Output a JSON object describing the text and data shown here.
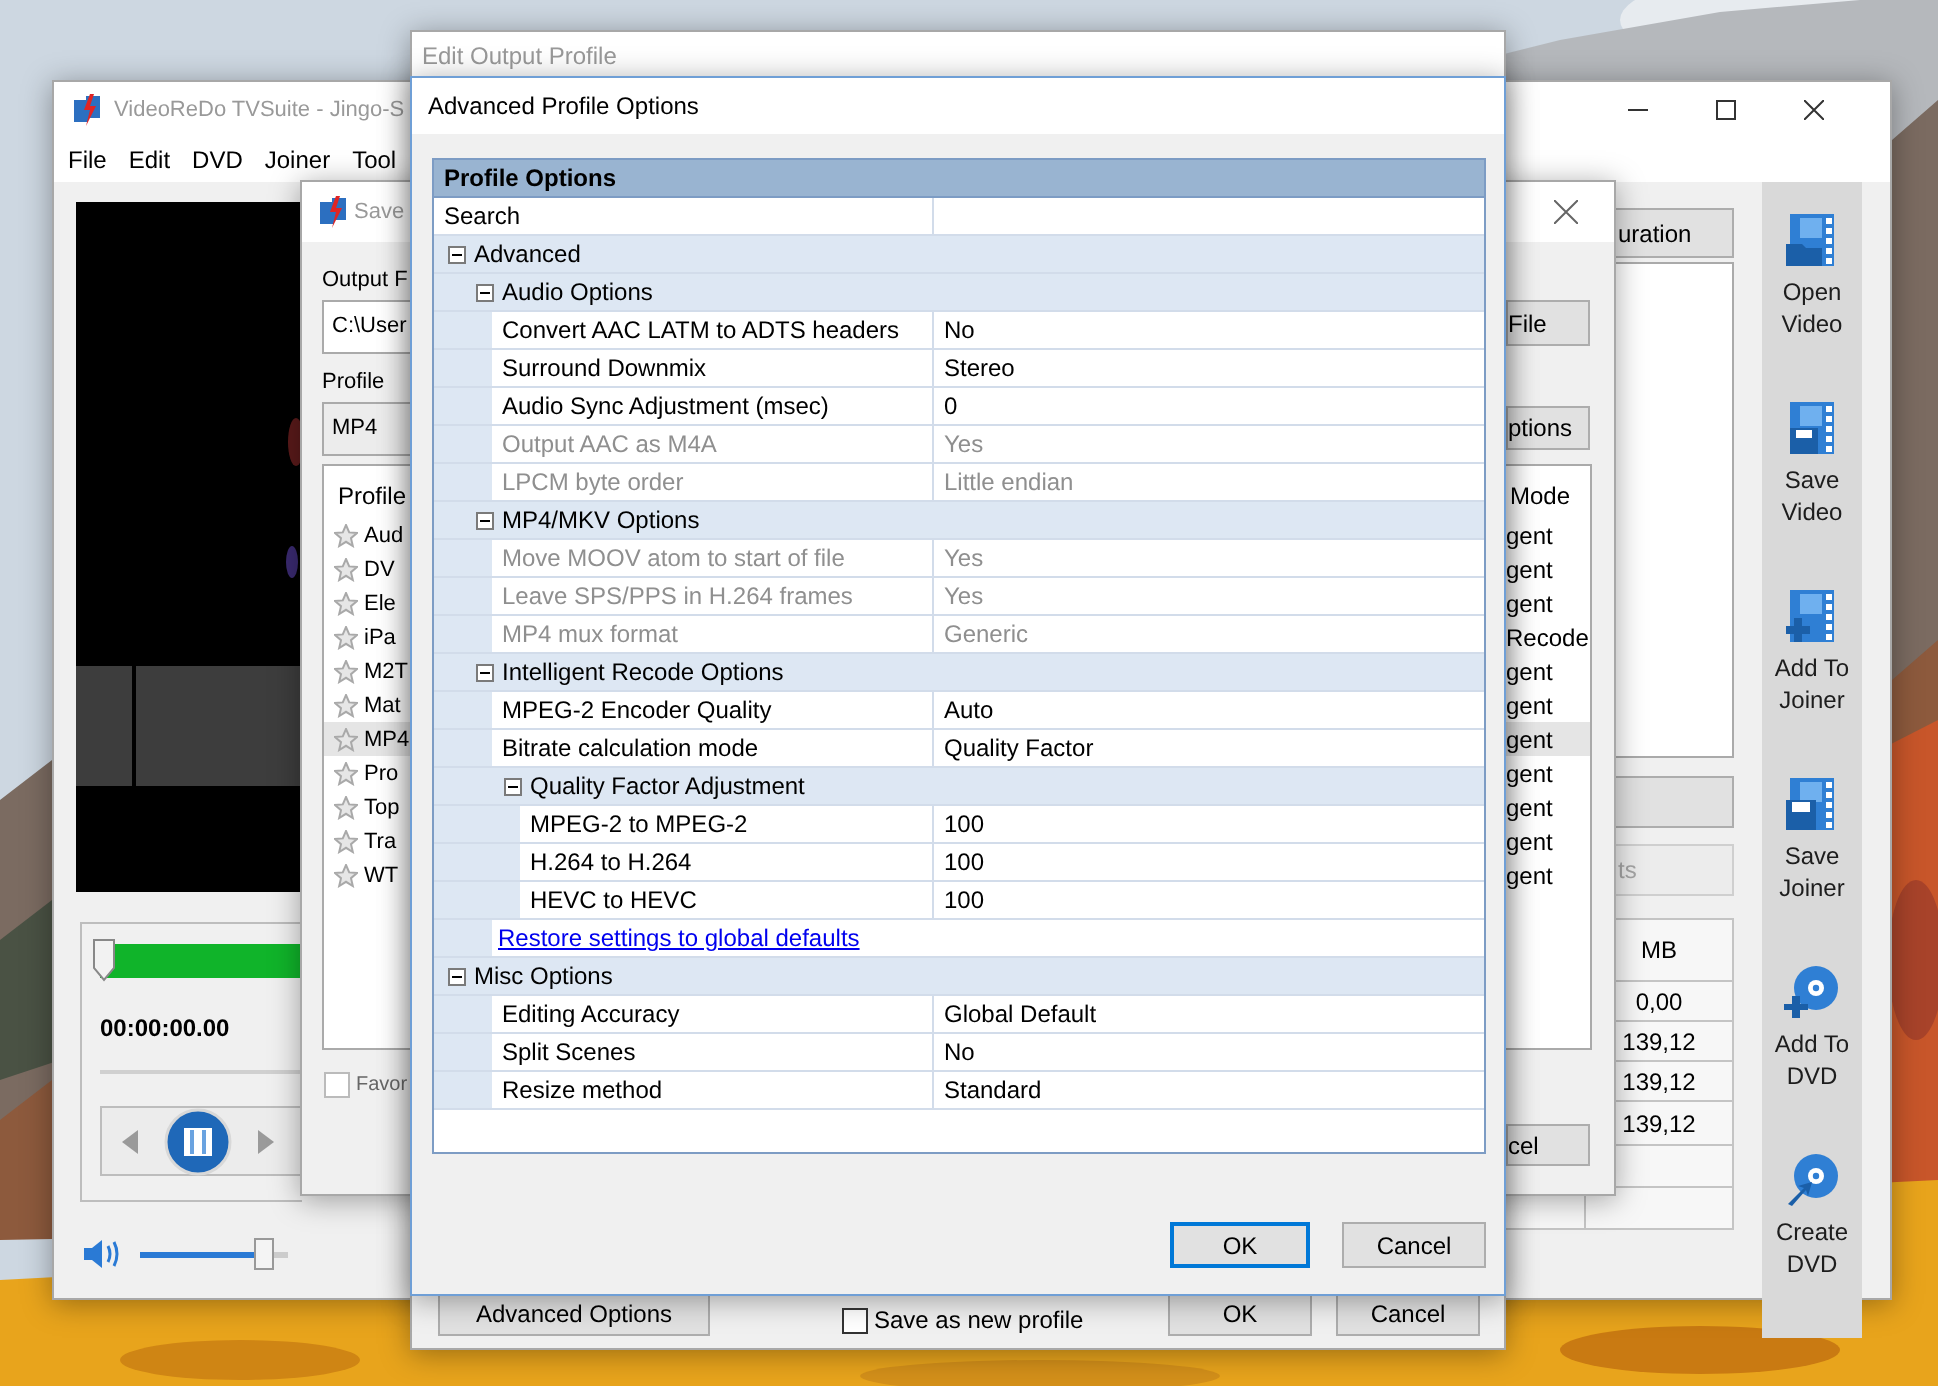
{
  "main_window": {
    "title": "VideoReDo TVSuite - Jingo-S",
    "menu": [
      "File",
      "Edit",
      "DVD",
      "Joiner",
      "Tool"
    ],
    "timecode": "00:00:00.00",
    "volume": {
      "level": 0.84
    },
    "side_buttons": [
      {
        "label": "uration",
        "disabled": false
      },
      {
        "disabled": false
      },
      {
        "label": "ts",
        "disabled": true
      }
    ],
    "size_column": {
      "header": "MB",
      "values": [
        "0,00",
        "139,12",
        "139,12",
        "139,12"
      ]
    },
    "toolbar": [
      {
        "kind": "open-video",
        "label": "Open Video"
      },
      {
        "kind": "save-video",
        "label": "Save Video"
      },
      {
        "kind": "add-joiner",
        "label": "Add To Joiner"
      },
      {
        "kind": "save-joiner",
        "label": "Save Joiner"
      },
      {
        "kind": "add-dvd",
        "label": "Add To DVD"
      },
      {
        "kind": "create-dvd",
        "label": "Create DVD"
      }
    ]
  },
  "save_window": {
    "title": "Save",
    "output_label": "Output F",
    "output_value": "C:\\User",
    "profile_label": "Profile",
    "profile_value": "MP4",
    "file_button": "File",
    "options_button": "ptions",
    "cancel_button": "cel",
    "list": {
      "header": "Profile",
      "mode_header": "Mode",
      "rows": [
        {
          "name": "Aud",
          "mode": "gent",
          "selected": false
        },
        {
          "name": "DV",
          "mode": "gent",
          "selected": false
        },
        {
          "name": "Ele",
          "mode": "gent",
          "selected": false
        },
        {
          "name": "iPa",
          "mode": "Recode",
          "selected": false
        },
        {
          "name": "M2T",
          "mode": "gent",
          "selected": false
        },
        {
          "name": "Mat",
          "mode": "gent",
          "selected": false
        },
        {
          "name": "MP4",
          "mode": "gent",
          "selected": true
        },
        {
          "name": "Pro",
          "mode": "gent",
          "selected": false
        },
        {
          "name": "Top",
          "mode": "gent",
          "selected": false
        },
        {
          "name": "Tra",
          "mode": "gent",
          "selected": false
        },
        {
          "name": "WT",
          "mode": "gent",
          "selected": false
        }
      ]
    },
    "favorite": {
      "label": "Favor",
      "checked": false
    }
  },
  "edit_window": {
    "title": "Edit Output Profile",
    "advanced_button": "Advanced Options",
    "save_new": {
      "label": "Save as new profile",
      "checked": false
    },
    "ok": "OK",
    "cancel": "Cancel"
  },
  "advanced_dialog": {
    "title": "Advanced Profile Options",
    "ok": "OK",
    "cancel": "Cancel",
    "grid": {
      "header": "Profile Options",
      "search_label": "Search",
      "rows": [
        {
          "kind": "category",
          "label": "Advanced",
          "expanded": true,
          "children": [
            {
              "kind": "category",
              "label": "Audio Options",
              "expanded": true,
              "children": [
                {
                  "kind": "property",
                  "label": "Convert AAC LATM to ADTS headers",
                  "value": "No",
                  "disabled": false
                },
                {
                  "kind": "property",
                  "label": "Surround Downmix",
                  "value": "Stereo",
                  "disabled": false
                },
                {
                  "kind": "property",
                  "label": "Audio Sync Adjustment (msec)",
                  "value": "0",
                  "disabled": false
                },
                {
                  "kind": "property",
                  "label": "Output AAC as M4A",
                  "value": "Yes",
                  "disabled": true
                },
                {
                  "kind": "property",
                  "label": "LPCM byte order",
                  "value": "Little endian",
                  "disabled": true
                }
              ]
            },
            {
              "kind": "category",
              "label": "MP4/MKV Options",
              "expanded": true,
              "children": [
                {
                  "kind": "property",
                  "label": "Move MOOV atom to start of file",
                  "value": "Yes",
                  "disabled": true
                },
                {
                  "kind": "property",
                  "label": "Leave SPS/PPS in H.264 frames",
                  "value": "Yes",
                  "disabled": true
                },
                {
                  "kind": "property",
                  "label": "MP4 mux format",
                  "value": "Generic",
                  "disabled": true
                }
              ]
            },
            {
              "kind": "category",
              "label": "Intelligent Recode Options",
              "expanded": true,
              "children": [
                {
                  "kind": "property",
                  "label": "MPEG-2 Encoder Quality",
                  "value": "Auto",
                  "disabled": false
                },
                {
                  "kind": "property",
                  "label": "Bitrate calculation mode",
                  "value": "Quality Factor",
                  "disabled": false
                },
                {
                  "kind": "category",
                  "label": "Quality Factor Adjustment",
                  "expanded": true,
                  "children": [
                    {
                      "kind": "property",
                      "label": "MPEG-2 to MPEG-2",
                      "value": "100",
                      "disabled": false
                    },
                    {
                      "kind": "property",
                      "label": "H.264 to H.264",
                      "value": "100",
                      "disabled": false
                    },
                    {
                      "kind": "property",
                      "label": "HEVC to HEVC",
                      "value": "100",
                      "disabled": false
                    }
                  ]
                }
              ]
            },
            {
              "kind": "link",
              "label": "Restore settings to global defaults"
            }
          ]
        },
        {
          "kind": "category",
          "label": "Misc Options",
          "expanded": true,
          "children": [
            {
              "kind": "property",
              "label": "Editing Accuracy",
              "value": "Global Default",
              "disabled": false
            },
            {
              "kind": "property",
              "label": "Split Scenes",
              "value": "No",
              "disabled": false
            },
            {
              "kind": "property",
              "label": "Resize method",
              "value": "Standard",
              "disabled": false
            }
          ]
        }
      ]
    }
  }
}
